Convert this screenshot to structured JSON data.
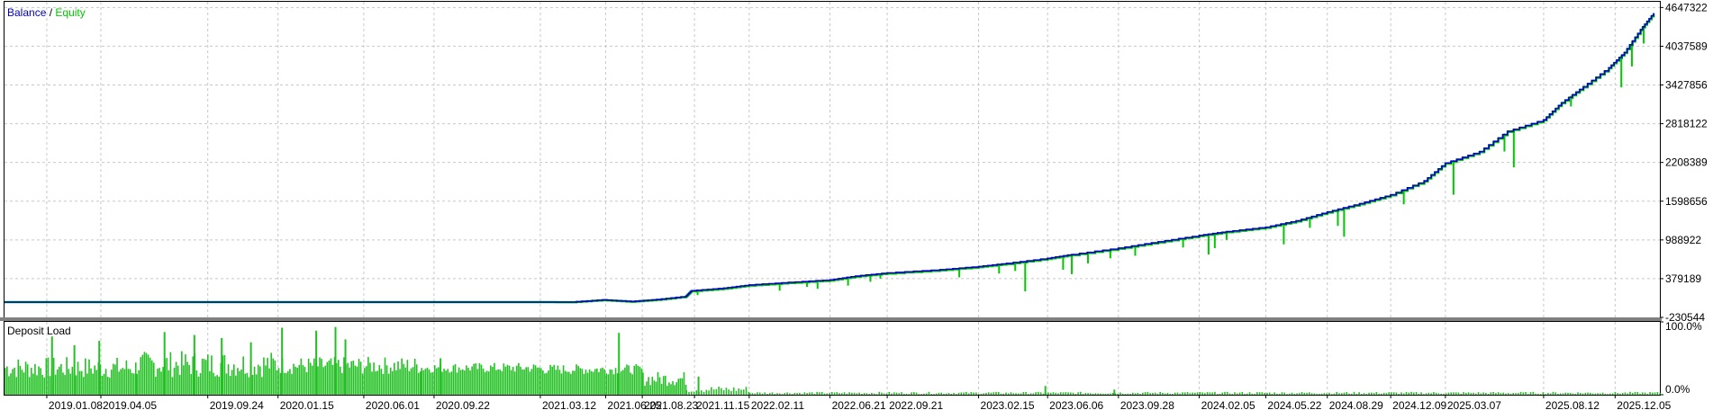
{
  "colors": {
    "balance": "#0000c8",
    "equity": "#00c800",
    "load": "#22c022",
    "grid": "#c8c8c8",
    "axis": "#000000",
    "separator": "#808080",
    "background": "#ffffff"
  },
  "icons": [],
  "chart_data": [
    {
      "type": "line",
      "legend": {
        "balance_label": "Balance",
        "separator": "/",
        "equity_label": "Equity"
      },
      "legend_position": "top-left",
      "grid": true,
      "y_axis_side": "right",
      "yticks": [
        "4647322",
        "4037589",
        "3427856",
        "2818122",
        "2208389",
        "1598656",
        "988922",
        "379189",
        "-230544"
      ],
      "ylim": [
        -230544,
        4737000
      ],
      "xlim": [
        "2018-11-01",
        "2026-02-15"
      ],
      "series": [
        {
          "name": "Balance",
          "points": [
            [
              "2018-11-01",
              10000
            ],
            [
              "2019-06-01",
              10000
            ],
            [
              "2020-01-15",
              10000
            ],
            [
              "2020-09-01",
              10000
            ],
            [
              "2021-03-12",
              10000
            ],
            [
              "2021-05-01",
              10000
            ],
            [
              "2021-06-20",
              45000
            ],
            [
              "2021-08-05",
              20000
            ],
            [
              "2021-09-15",
              50000
            ],
            [
              "2021-11-01",
              100000
            ],
            [
              "2021-11-10",
              190000
            ],
            [
              "2022-01-01",
              230000
            ],
            [
              "2022-02-11",
              280000
            ],
            [
              "2022-04-15",
              320000
            ],
            [
              "2022-06-21",
              360000
            ],
            [
              "2022-08-01",
              420000
            ],
            [
              "2022-09-21",
              470000
            ],
            [
              "2022-12-15",
              520000
            ],
            [
              "2023-02-15",
              570000
            ],
            [
              "2023-04-01",
              620000
            ],
            [
              "2023-06-06",
              700000
            ],
            [
              "2023-07-15",
              760000
            ],
            [
              "2023-09-28",
              860000
            ],
            [
              "2023-12-01",
              960000
            ],
            [
              "2024-02-05",
              1060000
            ],
            [
              "2024-03-20",
              1120000
            ],
            [
              "2024-05-22",
              1190000
            ],
            [
              "2024-07-10",
              1290000
            ],
            [
              "2024-08-29",
              1430000
            ],
            [
              "2024-10-20",
              1560000
            ],
            [
              "2024-12-09",
              1700000
            ],
            [
              "2025-02-01",
              1920000
            ],
            [
              "2025-03-07",
              2200000
            ],
            [
              "2025-05-01",
              2380000
            ],
            [
              "2025-06-15",
              2700000
            ],
            [
              "2025-08-12",
              2880000
            ],
            [
              "2025-09-10",
              3150000
            ],
            [
              "2025-10-15",
              3400000
            ],
            [
              "2025-11-25",
              3700000
            ],
            [
              "2025-12-20",
              3940000
            ],
            [
              "2026-01-15",
              4300000
            ],
            [
              "2026-02-05",
              4560000
            ]
          ]
        },
        {
          "name": "Equity",
          "points": [
            [
              "2018-11-01",
              10000
            ],
            [
              "2019-06-01",
              10000
            ],
            [
              "2020-01-15",
              10000
            ],
            [
              "2020-09-01",
              10000
            ],
            [
              "2021-03-12",
              10000
            ],
            [
              "2021-05-01",
              8000
            ],
            [
              "2021-06-20",
              40000
            ],
            [
              "2021-08-05",
              15000
            ],
            [
              "2021-09-15",
              45000
            ],
            [
              "2021-11-01",
              95000
            ],
            [
              "2021-11-10",
              180000
            ],
            [
              "2022-01-01",
              220000
            ],
            [
              "2022-02-11",
              270000
            ],
            [
              "2022-04-15",
              310000
            ],
            [
              "2022-06-21",
              350000
            ],
            [
              "2022-08-01",
              410000
            ],
            [
              "2022-09-21",
              460000
            ],
            [
              "2022-12-15",
              510000
            ],
            [
              "2023-02-15",
              560000
            ],
            [
              "2023-04-01",
              610000
            ],
            [
              "2023-06-06",
              690000
            ],
            [
              "2023-07-15",
              750000
            ],
            [
              "2023-09-28",
              850000
            ],
            [
              "2023-12-01",
              950000
            ],
            [
              "2024-02-05",
              1050000
            ],
            [
              "2024-03-20",
              1110000
            ],
            [
              "2024-05-22",
              1180000
            ],
            [
              "2024-07-10",
              1280000
            ],
            [
              "2024-08-29",
              1420000
            ],
            [
              "2024-10-20",
              1550000
            ],
            [
              "2024-12-09",
              1690000
            ],
            [
              "2025-02-01",
              1910000
            ],
            [
              "2025-03-07",
              2190000
            ],
            [
              "2025-05-01",
              2370000
            ],
            [
              "2025-06-15",
              2690000
            ],
            [
              "2025-08-12",
              2870000
            ],
            [
              "2025-09-10",
              3140000
            ],
            [
              "2025-10-15",
              3390000
            ],
            [
              "2025-11-25",
              3690000
            ],
            [
              "2025-12-20",
              3930000
            ],
            [
              "2026-01-15",
              4290000
            ],
            [
              "2026-02-05",
              4550000
            ]
          ],
          "drawdowns": [
            [
              "2021-11-20",
              120000
            ],
            [
              "2022-04-01",
              190000
            ],
            [
              "2022-05-15",
              250000
            ],
            [
              "2022-06-01",
              220000
            ],
            [
              "2022-07-20",
              270000
            ],
            [
              "2022-08-25",
              330000
            ],
            [
              "2022-09-10",
              380000
            ],
            [
              "2023-01-15",
              400000
            ],
            [
              "2023-03-20",
              460000
            ],
            [
              "2023-04-15",
              500000
            ],
            [
              "2023-05-01",
              180000
            ],
            [
              "2023-07-01",
              520000
            ],
            [
              "2023-07-15",
              450000
            ],
            [
              "2023-08-10",
              620000
            ],
            [
              "2023-09-15",
              700000
            ],
            [
              "2023-10-25",
              740000
            ],
            [
              "2024-01-10",
              870000
            ],
            [
              "2024-02-20",
              760000
            ],
            [
              "2024-03-01",
              860000
            ],
            [
              "2024-03-20",
              990000
            ],
            [
              "2024-06-20",
              920000
            ],
            [
              "2024-08-01",
              1180000
            ],
            [
              "2024-09-15",
              1210000
            ],
            [
              "2024-09-25",
              1040000
            ],
            [
              "2024-12-30",
              1550000
            ],
            [
              "2025-03-20",
              1700000
            ],
            [
              "2025-06-10",
              2380000
            ],
            [
              "2025-06-25",
              2130000
            ],
            [
              "2025-09-25",
              3090000
            ],
            [
              "2025-12-15",
              3390000
            ],
            [
              "2026-01-01",
              3720000
            ],
            [
              "2026-01-20",
              4080000
            ]
          ]
        }
      ]
    },
    {
      "type": "bar",
      "title": "Deposit Load",
      "y_axis_side": "right",
      "yticks": [
        "100.0%",
        "0.0%"
      ],
      "ylim": [
        0,
        100
      ],
      "xlim": [
        "2018-11-01",
        "2026-02-15"
      ],
      "xticks": [
        "2019.01.08",
        "2019.04.05",
        "2019.09.24",
        "2020.01.15",
        "2020.06.01",
        "2020.09.22",
        "2021.03.12",
        "2021.06.25",
        "2021.08.23",
        "2021.11.15",
        "2022.02.11",
        "2022.06.21",
        "2022.09.21",
        "2023.02.15",
        "2023.06.06",
        "2023.09.28",
        "2024.02.05",
        "2024.05.22",
        "2024.08.29",
        "2024.12.09",
        "2025.03.07",
        "2025.08.12",
        "2025.12.05"
      ],
      "segments": [
        {
          "start": "2018-11-01",
          "end": "2019-06-01",
          "min": 22,
          "max": 52,
          "spikes": [
            [
              "2019-01-15",
              80
            ],
            [
              "2019-02-20",
              68
            ],
            [
              "2019-04-01",
              74
            ]
          ]
        },
        {
          "start": "2019-06-01",
          "end": "2020-01-15",
          "min": 24,
          "max": 60,
          "spikes": [
            [
              "2019-07-15",
              86
            ],
            [
              "2019-09-01",
              82
            ],
            [
              "2019-10-15",
              78
            ],
            [
              "2019-12-01",
              72
            ]
          ]
        },
        {
          "start": "2020-01-15",
          "end": "2020-09-01",
          "min": 28,
          "max": 52,
          "spikes": [
            [
              "2020-01-20",
              92
            ],
            [
              "2020-03-15",
              88
            ],
            [
              "2020-04-15",
              93
            ],
            [
              "2020-05-01",
              76
            ]
          ]
        },
        {
          "start": "2020-09-01",
          "end": "2021-03-12",
          "min": 30,
          "max": 44,
          "spikes": [
            [
              "2020-10-01",
              50
            ]
          ]
        },
        {
          "start": "2021-03-12",
          "end": "2021-08-23",
          "min": 28,
          "max": 42,
          "spikes": [
            [
              "2021-07-15",
              85
            ]
          ]
        },
        {
          "start": "2021-08-23",
          "end": "2021-11-01",
          "min": 12,
          "max": 32,
          "spikes": []
        },
        {
          "start": "2021-11-01",
          "end": "2022-02-11",
          "min": 3,
          "max": 12,
          "spikes": [
            [
              "2021-11-20",
              25
            ]
          ]
        },
        {
          "start": "2022-02-11",
          "end": "2026-02-15",
          "min": 1,
          "max": 4,
          "spikes": [
            [
              "2023-06-01",
              12
            ],
            [
              "2023-09-20",
              7
            ]
          ]
        }
      ]
    }
  ]
}
